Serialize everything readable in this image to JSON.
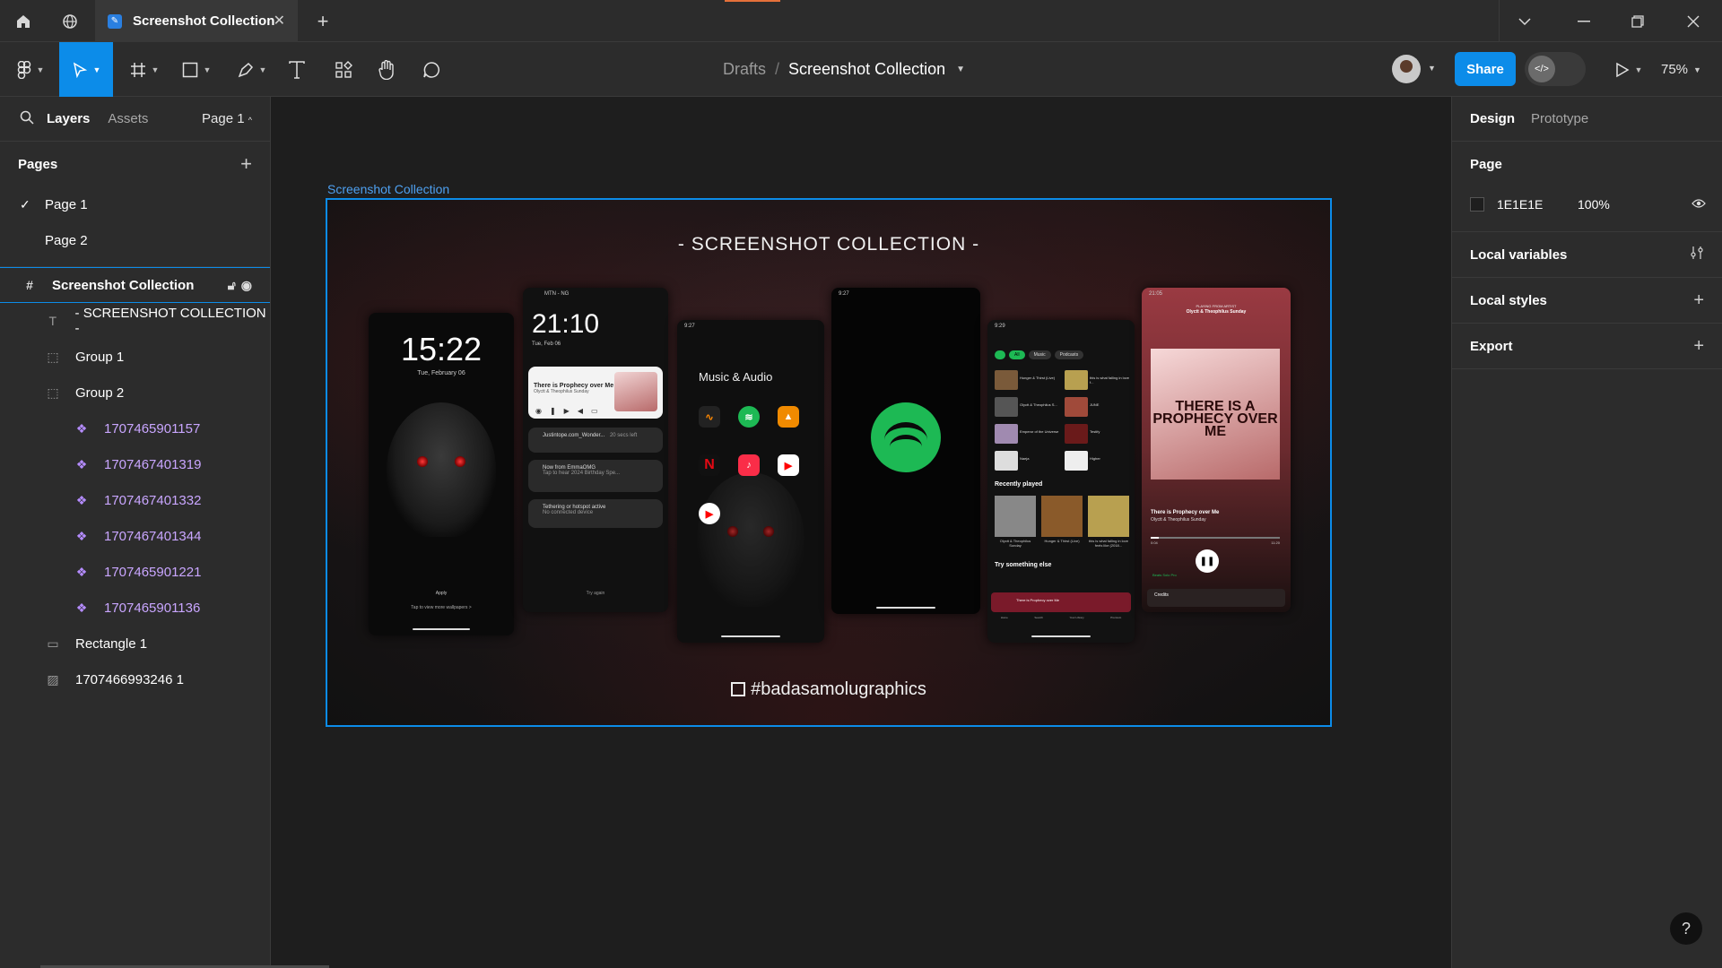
{
  "titlebar": {
    "tab_title": "Screenshot Collection",
    "icons": [
      "home-icon",
      "globe-icon",
      "close-icon",
      "plus-icon",
      "chevron-down-icon",
      "minimize-icon",
      "restore-icon",
      "window-close-icon"
    ]
  },
  "toolbar": {
    "breadcrumb_drafts": "Drafts",
    "breadcrumb_sep": "/",
    "file_name": "Screenshot Collection",
    "share_label": "Share",
    "zoom_label": "75%"
  },
  "left_panel": {
    "tab_layers": "Layers",
    "tab_assets": "Assets",
    "page_selector": "Page 1",
    "pages_heading": "Pages",
    "pages": [
      "Page 1",
      "Page 2"
    ],
    "layers": [
      {
        "name": "Screenshot Collection",
        "type": "frame"
      },
      {
        "name": "- SCREENSHOT COLLECTION -",
        "type": "text"
      },
      {
        "name": "Group 1",
        "type": "group"
      },
      {
        "name": "Group 2",
        "type": "group"
      },
      {
        "name": "1707465901157",
        "type": "component"
      },
      {
        "name": "1707467401319",
        "type": "component"
      },
      {
        "name": "1707467401332",
        "type": "component"
      },
      {
        "name": "1707467401344",
        "type": "component"
      },
      {
        "name": "1707465901221",
        "type": "component"
      },
      {
        "name": "1707465901136",
        "type": "component"
      },
      {
        "name": "Rectangle 1",
        "type": "rectangle"
      },
      {
        "name": "1707466993246 1",
        "type": "image"
      }
    ]
  },
  "right_panel": {
    "tab_design": "Design",
    "tab_prototype": "Prototype",
    "page_heading": "Page",
    "page_fill_hex": "1E1E1E",
    "page_fill_opacity": "100%",
    "local_variables": "Local variables",
    "local_styles": "Local styles",
    "export": "Export"
  },
  "canvas": {
    "frame_label": "Screenshot Collection",
    "frame_title": "- SCREENSHOT COLLECTION -",
    "frame_tag": "#badasamolugraphics",
    "accent_color": "#0c8ce9",
    "phones": {
      "lock_time": "15:22",
      "lock_date": "Tue, February 06",
      "lock_apply": "Apply",
      "lock_hint": "Tap to view more wallpapers  >",
      "shade_time": "21:10",
      "shade_date": "Tue, Feb 06",
      "shade_carrier": "MTN - NG",
      "shade_song": "There is Prophecy over Me",
      "shade_artist": "Olyctt & Theophilus Sunday",
      "shade_notif1": "Justintope.com_Wonder...",
      "shade_notif1_meta": "20 secs left",
      "shade_notif2": "Now from EmmaOMG",
      "shade_notif2_sub": "Tap to hear 2024 Birthday Spe...",
      "shade_notif3": "Tethering or hotspot active",
      "shade_notif3_sub": "No connected device",
      "shade_try": "Try again",
      "folder_time": "9:27",
      "folder_name": "Music & Audio",
      "folder_apps": [
        "Audiomack",
        "Spotify",
        "VLC",
        "Netflix",
        "Music",
        "YouTube",
        "YT Music"
      ],
      "splash_time": "9:27",
      "home_time": "9:29",
      "home_chips": [
        "All",
        "Music",
        "Podcasts"
      ],
      "home_tiles": [
        "Hunger & Thirst (Live)",
        "this is what falling in love f...",
        "Olyctt & Theophilus S...",
        "JUNE",
        "Emperor of the Universe",
        "Testify",
        "Naeja",
        "Higher"
      ],
      "home_recent": "Recently played",
      "home_recent_items": [
        "Olyctt & Theophilus Sunday",
        "Hunger & Thirst (Live)",
        "this is what falling in love feels like (2018..."
      ],
      "home_try": "Try something else",
      "home_mini_song": "There is Prophecy over Me",
      "home_nav": [
        "Home",
        "Search",
        "Your Library",
        "Premium"
      ],
      "player_time": "21:05",
      "player_from": "PLAYING FROM ARTIST",
      "player_artist_head": "Olyctt & Theophilus Sunday",
      "player_art_text": "THERE IS A PROPHECY OVER ME",
      "player_song": "There is Prophecy over Me",
      "player_artist": "Olyctt & Theophilus Sunday",
      "player_elapsed": "0:04",
      "player_total": "11:20",
      "player_device": "Beats Solo Pro",
      "player_credits": "Credits"
    }
  }
}
